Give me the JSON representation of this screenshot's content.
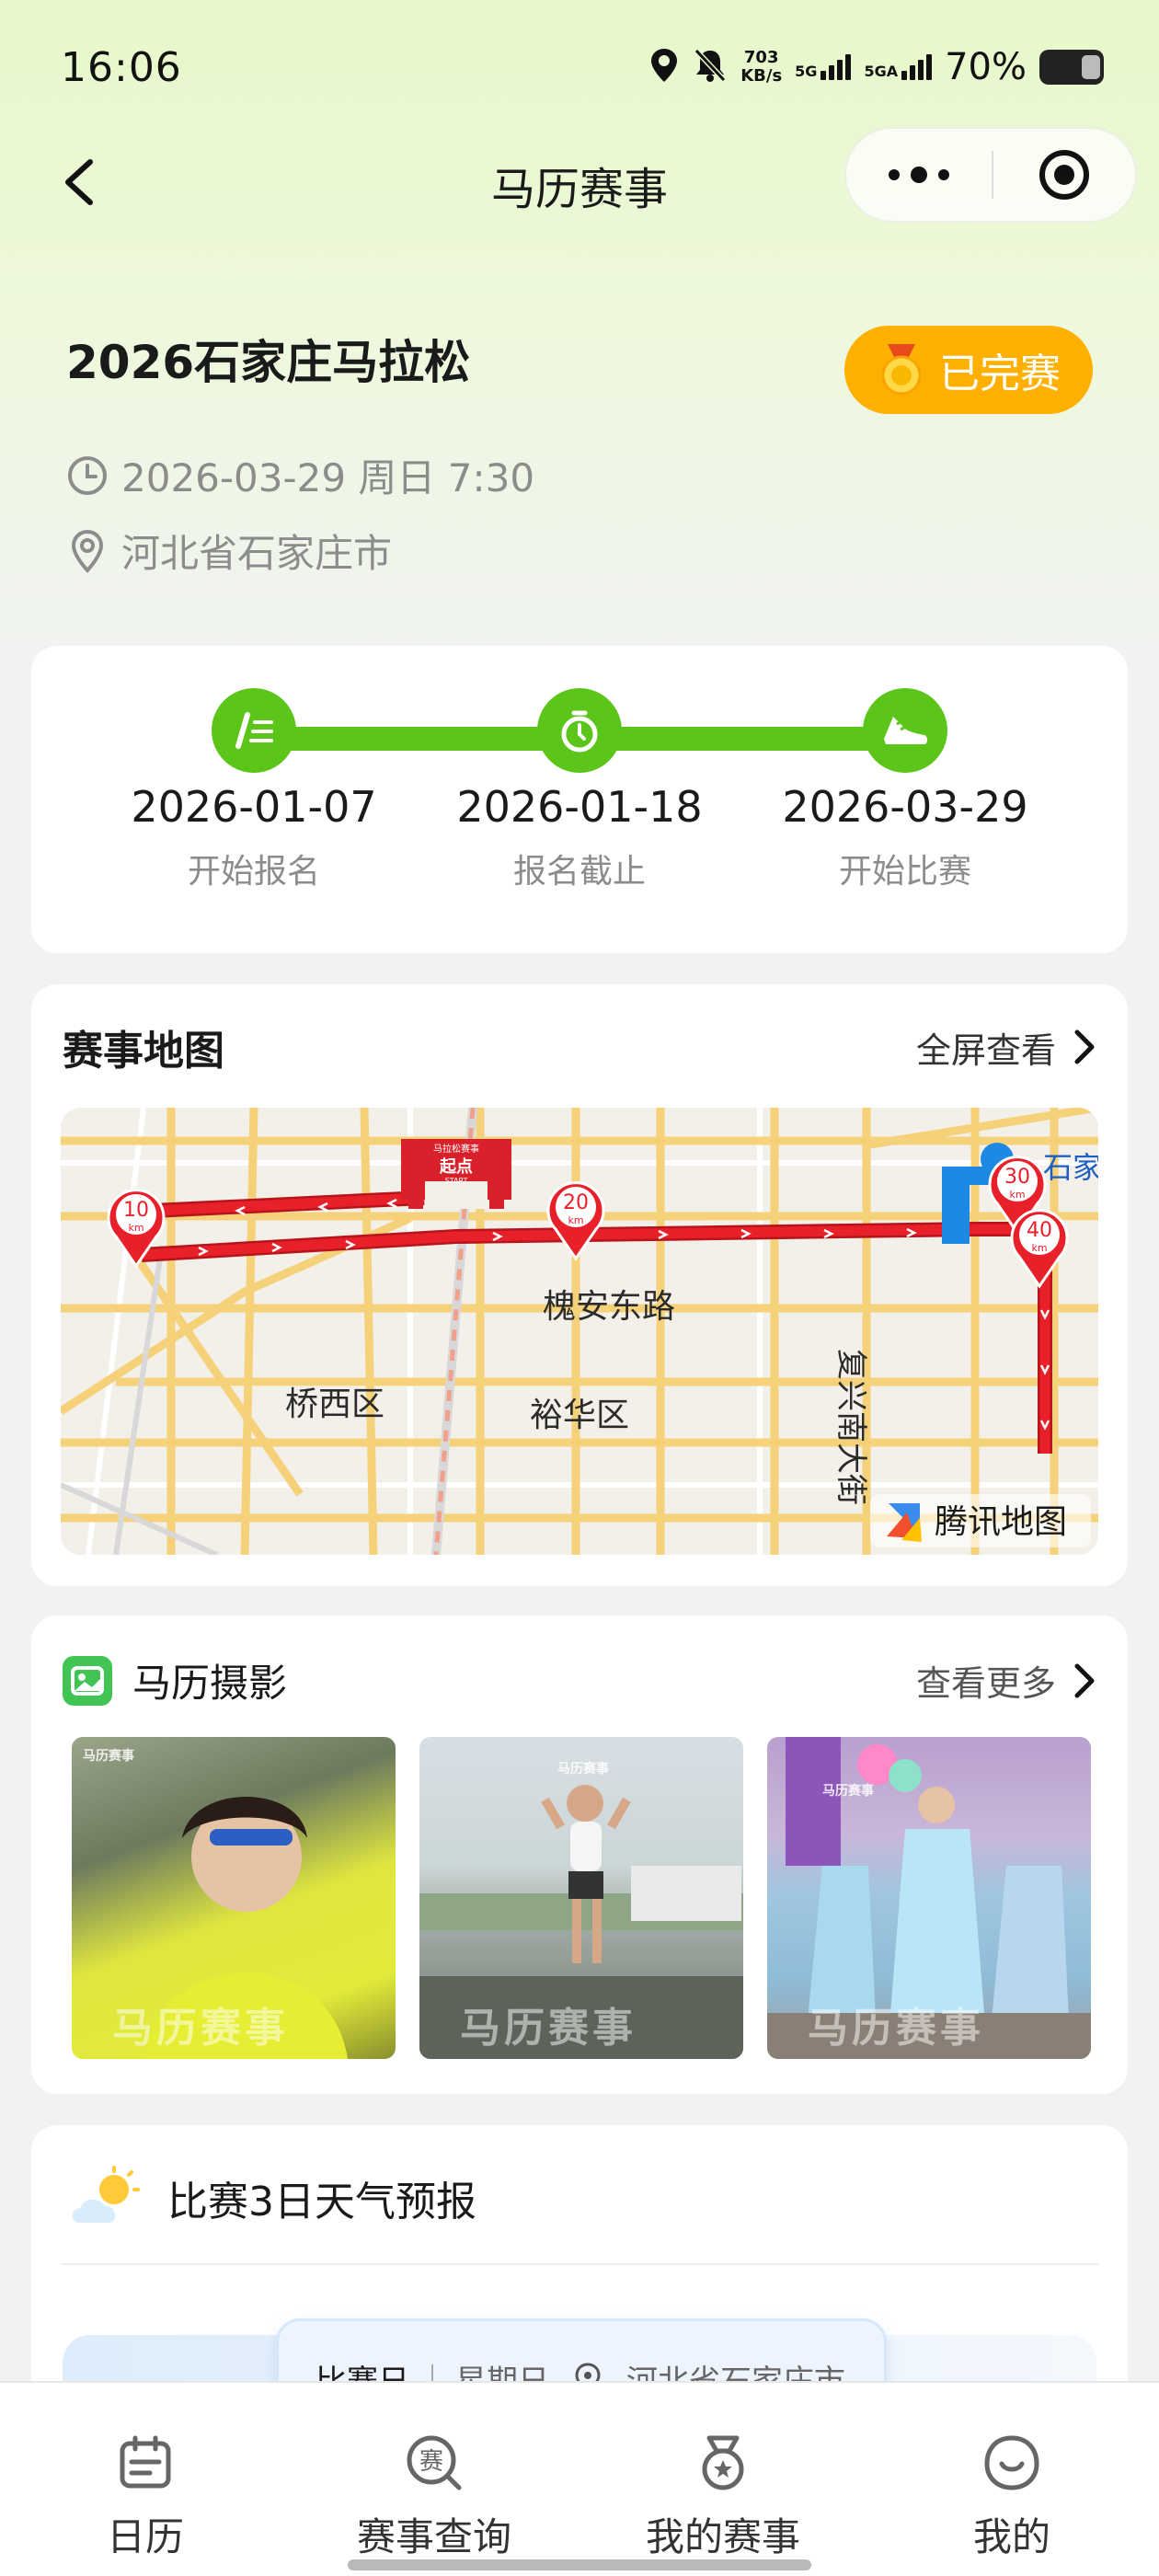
{
  "status_bar": {
    "time": "16:06",
    "net_speed_value": "703",
    "net_speed_unit": "KB/s",
    "sim1_label": "5G",
    "sim2_label": "5GA",
    "battery": "70%",
    "icons": [
      "location-icon",
      "mute-bell-icon",
      "signal-icon",
      "battery-icon"
    ]
  },
  "nav": {
    "title": "马历赛事",
    "icons": [
      "back-chevron-icon",
      "more-dots-icon",
      "target-icon"
    ]
  },
  "event": {
    "title": "2026石家庄马拉松",
    "status_badge": "已完赛",
    "datetime": "2026-03-29 周日 7:30",
    "location": "河北省石家庄市"
  },
  "timeline": {
    "steps": [
      {
        "date": "2026-01-07",
        "label": "开始报名",
        "icon": "pen-list-icon"
      },
      {
        "date": "2026-01-18",
        "label": "报名截止",
        "icon": "stopwatch-icon"
      },
      {
        "date": "2026-03-29",
        "label": "开始比赛",
        "icon": "running-shoe-icon"
      }
    ],
    "accent": "#5cc51a"
  },
  "map_card": {
    "title": "赛事地图",
    "link": "全屏查看",
    "labels": {
      "road": "槐安东路",
      "district1": "桥西区",
      "district2": "裕华区",
      "street": "复兴南大街",
      "place_fragment": "石家",
      "start_sign": "起点",
      "start_sign_sub": "START",
      "start_sign_top": "马拉松赛事",
      "provider": "腾讯地图"
    },
    "km_markers": [
      {
        "value": "10",
        "unit": "km"
      },
      {
        "value": "20",
        "unit": "km"
      },
      {
        "value": "30",
        "unit": "km"
      },
      {
        "value": "40",
        "unit": "km"
      }
    ],
    "route_color": "#e8202a"
  },
  "photo_card": {
    "title": "马历摄影",
    "link": "查看更多",
    "watermark": "马历赛事",
    "photos": [
      "runner-photo-1",
      "runner-photo-2",
      "runner-photo-3"
    ]
  },
  "weather_card": {
    "title": "比赛3日天气预报",
    "pill_day": "比赛日",
    "pill_weekday": "星期日",
    "pill_location": "河北省石家庄市"
  },
  "tabbar": {
    "tabs": [
      {
        "label": "日历",
        "icon": "calendar-icon"
      },
      {
        "label": "赛事查询",
        "icon": "race-search-icon"
      },
      {
        "label": "我的赛事",
        "icon": "medal-icon"
      },
      {
        "label": "我的",
        "icon": "profile-icon"
      }
    ]
  }
}
